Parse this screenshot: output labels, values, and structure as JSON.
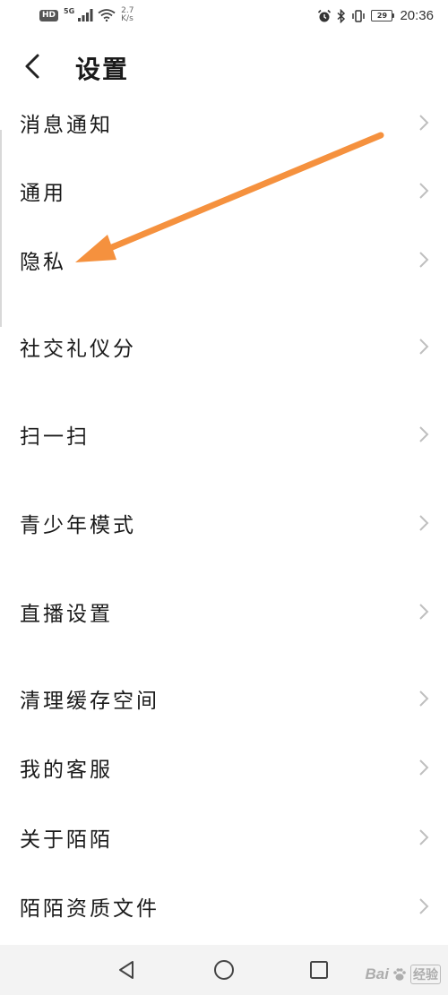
{
  "status_bar": {
    "hd": "HD",
    "network_type": "5G",
    "speed_value": "2.7",
    "speed_unit": "K/s",
    "battery": "29",
    "time": "20:36",
    "icons": [
      "signal-icon",
      "wifi-icon",
      "alarm-icon",
      "bluetooth-icon",
      "vibrate-icon",
      "battery-icon"
    ]
  },
  "header": {
    "back_icon": "back-chevron-icon",
    "title": "设置"
  },
  "menu": {
    "items": [
      {
        "label": "消息通知"
      },
      {
        "label": "通用"
      },
      {
        "label": "隐私"
      },
      {
        "label": "社交礼仪分"
      },
      {
        "label": "扫一扫"
      },
      {
        "label": "青少年模式"
      },
      {
        "label": "直播设置"
      },
      {
        "label": "清理缓存空间"
      },
      {
        "label": "我的客服"
      },
      {
        "label": "关于陌陌"
      },
      {
        "label": "陌陌资质文件"
      }
    ]
  },
  "annotation": {
    "color": "#f5913e",
    "points_to": "隐私"
  },
  "nav_bar": {
    "buttons": [
      "back-triangle-icon",
      "home-circle-icon",
      "recents-square-icon"
    ]
  },
  "watermark": {
    "text1": "Bai",
    "text2": "经验"
  },
  "colors": {
    "text": "#1a1a1a",
    "chevron": "#bfbfbf",
    "nav_bg": "#f3f3f3",
    "arrow": "#f5913e"
  }
}
